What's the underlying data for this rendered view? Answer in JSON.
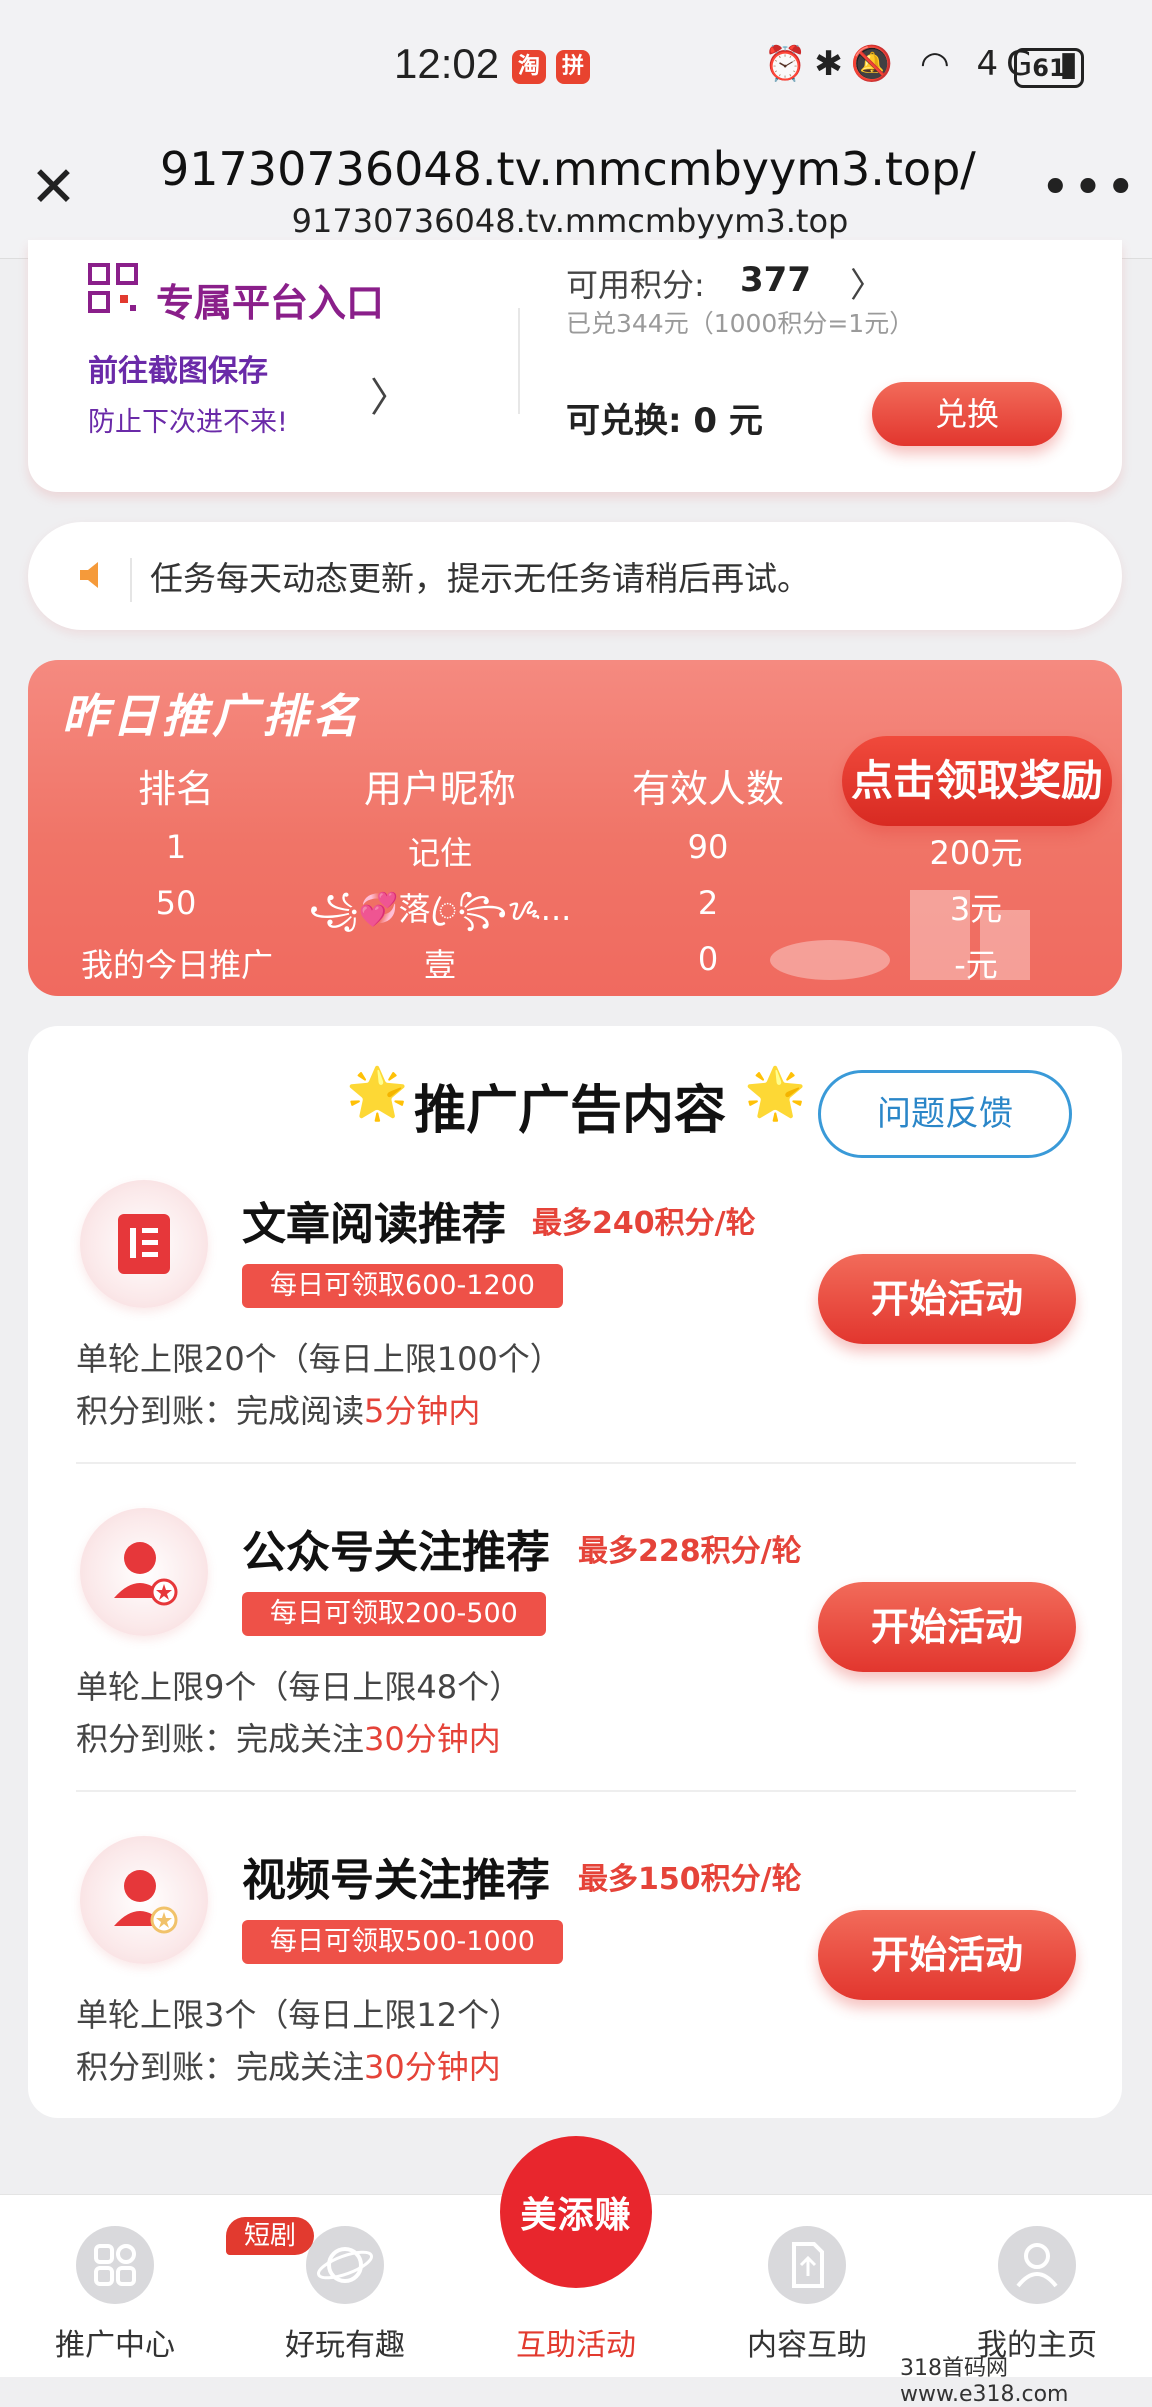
{
  "status_bar": {
    "time": "12:02",
    "badge1": "淘",
    "badge2": "拼",
    "icons": "⏰✱🔕 ◠ 4G ▮",
    "battery": "61"
  },
  "browser": {
    "close_icon": "close-icon",
    "url": "91730736048.tv.mmcmbyym3.top/...",
    "host": "91730736048.tv.mmcmbyym3.top",
    "more": "•••"
  },
  "entry_card": {
    "title": "专属平台入口",
    "link": "前往截图保存",
    "subtitle": "防止下次进不来!",
    "available_label": "可用积分:",
    "available_value": "377",
    "redeemed": "已兑344元（1000积分=1元）",
    "exchangeable": "可兑换: 0 元",
    "exchange_button": "兑换"
  },
  "notice": {
    "text": "任务每天动态更新，提示无任务请稍后再试。"
  },
  "ranking": {
    "title": "昨日推广排名",
    "claim_button": "点击领取奖励",
    "headers": [
      "排名",
      "用户昵称",
      "有效人数"
    ],
    "rows": [
      {
        "rank": "1",
        "name": "记住",
        "count": "90",
        "reward": "200元"
      },
      {
        "rank": "50",
        "name": "꧁💞落ꦿ꧂ᝰ...",
        "count": "2",
        "reward": "3元"
      },
      {
        "rank": "我的今日推广",
        "name": "壹",
        "count": "0",
        "reward": "-元"
      }
    ]
  },
  "ads": {
    "title": "推广广告内容",
    "star": "🌟",
    "feedback_button": "问题反馈",
    "items": [
      {
        "name": "文章阅读推荐",
        "max": "最多240积分/轮",
        "tag": "每日可领取600-1200",
        "limit": "单轮上限20个（每日上限100个）",
        "arrive_prefix": "积分到账：完成阅读",
        "arrive_time": "5分钟内",
        "button": "开始活动"
      },
      {
        "name": "公众号关注推荐",
        "max": "最多228积分/轮",
        "tag": "每日可领取200-500",
        "limit": "单轮上限9个（每日上限48个）",
        "arrive_prefix": "积分到账：完成关注",
        "arrive_time": "30分钟内",
        "button": "开始活动"
      },
      {
        "name": "视频号关注推荐",
        "max": "最多150积分/轮",
        "tag": "每日可领取500-1000",
        "limit": "单轮上限3个（每日上限12个）",
        "arrive_prefix": "积分到账：完成关注",
        "arrive_time": "30分钟内",
        "button": "开始活动"
      }
    ]
  },
  "nav": {
    "badge": "短剧",
    "center_logo": "美添赚",
    "items": [
      {
        "label": "推广中心",
        "icon": "grid-icon"
      },
      {
        "label": "好玩有趣",
        "icon": "planet-icon"
      },
      {
        "label": "互助活动",
        "icon": "logo-icon"
      },
      {
        "label": "内容互助",
        "icon": "document-icon"
      },
      {
        "label": "我的主页",
        "icon": "user-icon"
      }
    ],
    "active_color": "#e23a2f"
  },
  "watermark": "318首码网  www.e318.com"
}
